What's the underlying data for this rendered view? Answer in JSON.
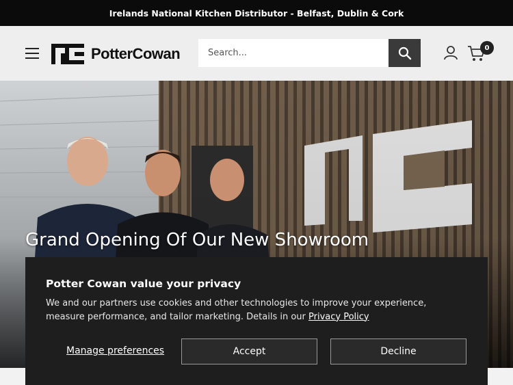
{
  "announcement": "Irelands National Kitchen Distributor - Belfast, Dublin & Cork",
  "header": {
    "logo_text": "PotterCowan",
    "search_placeholder": "Search...",
    "cart_count": "0"
  },
  "hero": {
    "title": "Grand Opening Of Our New Showroom"
  },
  "cookie": {
    "title": "Potter Cowan value your privacy",
    "text": "We and our partners use cookies and other technologies to improve your experience, measure performance, and tailor marketing. Details in our",
    "link": "Privacy Policy",
    "manage_label": "Manage preferences",
    "accept_label": "Accept",
    "decline_label": "Decline"
  },
  "colors": {
    "announce_bg": "#0b0b0b",
    "header_bg": "#eeeeee",
    "search_button": "#3a3a3a",
    "cookie_bg": "#1e1e1e"
  },
  "icons": [
    "menu-icon",
    "search-icon",
    "account-icon",
    "cart-icon"
  ]
}
